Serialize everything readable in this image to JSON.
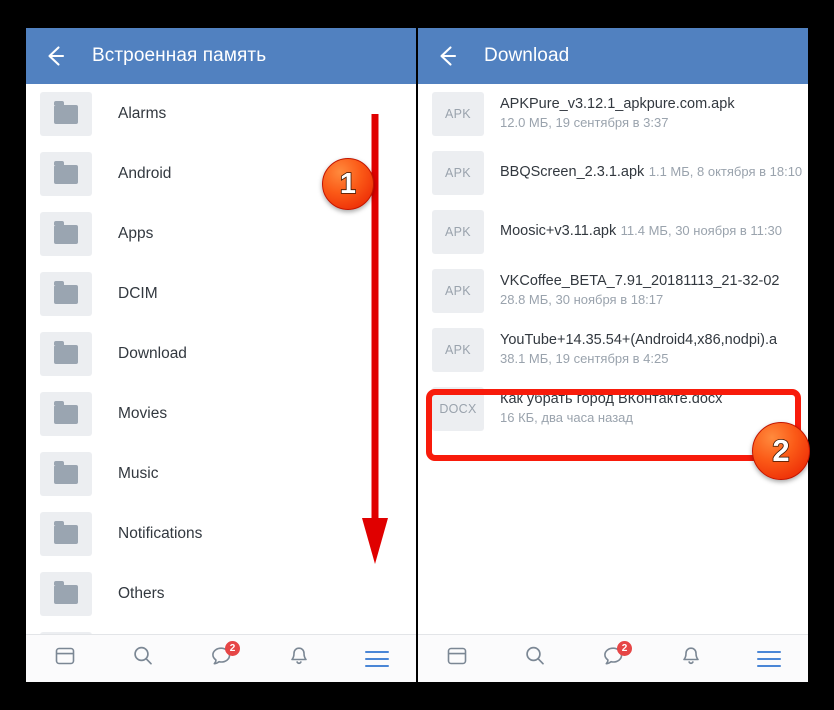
{
  "left_phone": {
    "appbar": {
      "back_icon": "back-arrow-icon",
      "title": "Встроенная память"
    },
    "folders": [
      {
        "name": "Alarms"
      },
      {
        "name": "Android"
      },
      {
        "name": "Apps"
      },
      {
        "name": "DCIM"
      },
      {
        "name": "Download"
      },
      {
        "name": "Movies"
      },
      {
        "name": "Music"
      },
      {
        "name": "Notifications"
      },
      {
        "name": "Others"
      },
      {
        "name": ""
      }
    ]
  },
  "right_phone": {
    "appbar": {
      "back_icon": "back-arrow-icon",
      "title": "Download"
    },
    "files": [
      {
        "type": "APK",
        "name": "APKPure_v3.12.1_apkpure.com.apk",
        "sub": "12.0 МБ, 19 сентября в 3:37"
      },
      {
        "type": "APK",
        "name": "BBQScreen_2.3.1.apk",
        "sub": "1.1 МБ, 8 октября в 18:10"
      },
      {
        "type": "APK",
        "name": "Moosic+v3.11.apk",
        "sub": "11.4 МБ, 30 ноября в 11:30"
      },
      {
        "type": "APK",
        "name": "VKCoffee_BETA_7.91_20181113_21-32-02",
        "sub": "28.8 МБ, 30 ноября в 18:17"
      },
      {
        "type": "APK",
        "name": "YouTube+14.35.54+(Android4,x86,nodpi).a",
        "sub": "38.1 МБ, 19 сентября в 4:25"
      },
      {
        "type": "DOCX",
        "name": "Как убрать город ВКонтакте.docx",
        "sub": "16 КБ, два часа назад"
      }
    ]
  },
  "bottom_nav": {
    "items": [
      {
        "icon": "feed-icon",
        "badge": ""
      },
      {
        "icon": "search-icon",
        "badge": ""
      },
      {
        "icon": "messages-icon",
        "badge": "2"
      },
      {
        "icon": "bell-icon",
        "badge": ""
      },
      {
        "icon": "hamburger-menu-icon",
        "badge": ""
      }
    ]
  },
  "annotations": {
    "step_one": "1",
    "step_two": "2",
    "arrow": "scroll-down-arrow",
    "highlight": "docx-file-highlight"
  },
  "colors": {
    "appbar_blue": "#5181c0",
    "accent_blue": "#4a86d6",
    "badge_red": "#e64646",
    "annotation_red": "#f81b0b",
    "tile_gray": "#eceef1",
    "text_primary": "#32383f",
    "text_secondary": "#9aa3ad"
  }
}
